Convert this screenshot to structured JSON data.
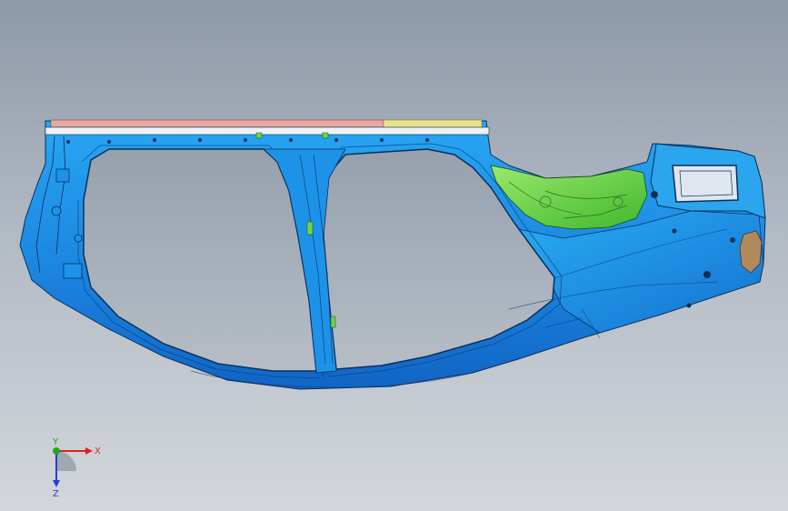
{
  "viewport": {
    "background_top": "#8e99a8",
    "background_bottom": "#d3d7dc"
  },
  "model": {
    "part_color": "#1f8de6",
    "highlight_green": "#6fd34a",
    "highlight_pink": "#e8a7a0",
    "highlight_yellow": "#e8e48a",
    "edge_color": "#0b2f5a"
  },
  "triad": {
    "x_label": "X",
    "y_label": "Y",
    "z_label": "Z",
    "x_color": "#e0201c",
    "y_color": "#1ea81e",
    "z_color": "#2a3bd8"
  }
}
